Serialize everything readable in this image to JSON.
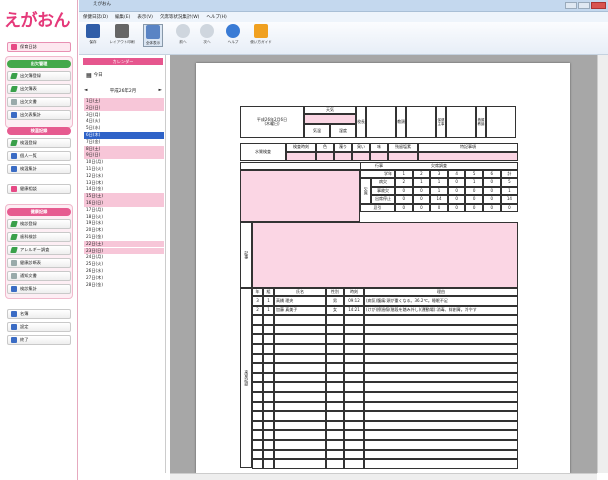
{
  "app": {
    "logo": "えがおん",
    "window_title": "えがおん",
    "sidebar": {
      "top_item": "保育日誌",
      "group1_title": "出欠管理",
      "group1_items": [
        "出欠簿登録",
        "出欠簿表",
        "出欠文書",
        "出欠表集計"
      ],
      "group2_title": "検温記録",
      "group2_items": [
        "検温登録",
        "個人一覧",
        "検温集計"
      ],
      "single_item": "健康相談",
      "group3_title": "健康記録",
      "group3_items": [
        "検診登録",
        "歯科検診",
        "アレルギー調査",
        "健康診断表",
        "通知文書",
        "検診集計"
      ],
      "bottom_items": [
        "名簿",
        "設定",
        "終了"
      ]
    }
  },
  "menu": [
    "保健日誌(D)",
    "編集(E)",
    "表示(V)",
    "欠席等状況集計(W)",
    "ヘルプ(H)"
  ],
  "toolbar": {
    "buttons": [
      "保存",
      "レイアウト印刷",
      "全体表示",
      "前へ",
      "次へ",
      "ヘルプ",
      "使い方ガイド"
    ]
  },
  "calendar": {
    "header": "カレンダー",
    "today_label": "今日",
    "month_label": "平成26年2月",
    "prev": "◄",
    "next": "►",
    "days": [
      "1日(土)",
      "2日(日)",
      "3日(月)",
      "4日(火)",
      "5日(水)",
      "6日(木)",
      "7日(金)",
      "8日(土)",
      "9日(日)",
      "10日(月)",
      "11日(火)",
      "12日(水)",
      "13日(木)",
      "14日(金)",
      "15日(土)",
      "16日(日)",
      "17日(月)",
      "18日(火)",
      "19日(水)",
      "20日(木)",
      "21日(金)",
      "22日(土)",
      "23日(日)",
      "24日(月)",
      "25日(火)",
      "26日(水)",
      "27日(木)",
      "28日(金)"
    ],
    "selected_index": 5
  },
  "form": {
    "date_text": "平成26年2月6日\n(木曜日)",
    "weather_label": "天気",
    "temp_label": "気温",
    "humidity_label": "湿度",
    "weather_headers": [
      "気温",
      "湿度"
    ],
    "principal": "校長",
    "vice": "教頭",
    "nurse": "保健主事",
    "nurse2": "養護教諭",
    "water_label": "水質検査",
    "water_cols": [
      "検査時刻",
      "色",
      "濁り",
      "臭い",
      "味",
      "残留塩素",
      "特記事項"
    ],
    "events_label": "行事",
    "attendance_label": "欠席調査",
    "att_grade_header": "学年",
    "att_row_header": "事項",
    "att_grades": [
      "1",
      "2",
      "3",
      "4",
      "5",
      "6",
      "計"
    ],
    "att_group": "欠席",
    "att_rows": [
      {
        "label": "病欠",
        "values": [
          "2",
          "1",
          "1",
          "0",
          "1",
          "0",
          "5"
        ]
      },
      {
        "label": "事故欠",
        "values": [
          "0",
          "0",
          "1",
          "0",
          "0",
          "0",
          "1"
        ]
      },
      {
        "label": "出席停止",
        "values": [
          "0",
          "0",
          "14",
          "0",
          "0",
          "0",
          "14"
        ]
      },
      {
        "label": "忌引",
        "values": [
          "0",
          "0",
          "0",
          "0",
          "0",
          "0",
          "0"
        ]
      }
    ],
    "notes_label": "記事",
    "visit_headers": [
      "年",
      "組",
      "氏名",
      "性別",
      "時刻",
      "理由"
    ],
    "visits": [
      {
        "year": "3",
        "class": "1",
        "name": "高橋 理央",
        "sex": "男",
        "time": "09:12",
        "reason": "(病気)腹痛:頭が重くなる。36.2℃。睡眠不足"
      },
      {
        "year": "2",
        "class": "1",
        "name": "加藤 真美子",
        "sex": "女",
        "time": "14:21",
        "reason": "(けが)擦過傷(階段を踏み外し)(運動場):消毒、絆創膏。冷やす"
      }
    ],
    "visitor_label": "来室記録"
  },
  "colors": {
    "accent": "#e64a85",
    "highlight_row": "#f7c6d8",
    "selected_row": "#2f63c8",
    "green": "#44a84a"
  }
}
